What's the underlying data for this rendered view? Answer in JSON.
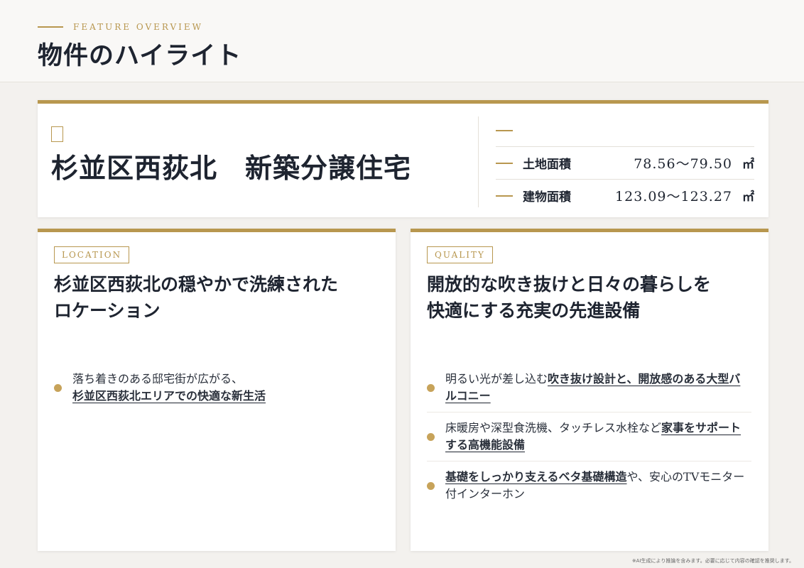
{
  "header": {
    "eyebrow": "FEATURE OVERVIEW",
    "title": "物件のハイライト"
  },
  "summary": {
    "property_name": "杉並区西荻北　新築分譲住宅",
    "specs": [
      {
        "label": "",
        "value": "",
        "unit": ""
      },
      {
        "label": "土地面積",
        "value": "78.56〜79.50",
        "unit": "㎡"
      },
      {
        "label": "建物面積",
        "value": "123.09〜123.27",
        "unit": "㎡"
      }
    ]
  },
  "location": {
    "tag": "LOCATION",
    "heading_line1": "杉並区西荻北の穏やかで洗練された",
    "heading_line2": "ロケーション",
    "bullets": [
      {
        "pre": "落ち着きのある邸宅街が広がる、",
        "highlight": "杉並区西荻北エリアでの快適な新生活",
        "post": ""
      }
    ]
  },
  "quality": {
    "tag": "QUALITY",
    "heading_line1": "開放的な吹き抜けと日々の暮らしを",
    "heading_line2": "快適にする充実の先進設備",
    "bullets": [
      {
        "pre": "明るい光が差し込む",
        "highlight": "吹き抜け設計と、開放感のある大型バルコニー",
        "post": ""
      },
      {
        "pre": "床暖房や深型食洗機、タッチレス水栓など",
        "highlight": "家事をサポートする高機能設備",
        "post": ""
      },
      {
        "pre": "",
        "highlight": "基礎をしっかり支えるベタ基礎構造",
        "post": "や、安心のTVモニター付インターホン"
      }
    ]
  },
  "footnote": "※AI生成により推論を含みます。必要に応じて内容の確認を推奨します。",
  "colors": {
    "accent": "#b8974f",
    "text": "#1e2430",
    "background": "#f3f1ee"
  }
}
